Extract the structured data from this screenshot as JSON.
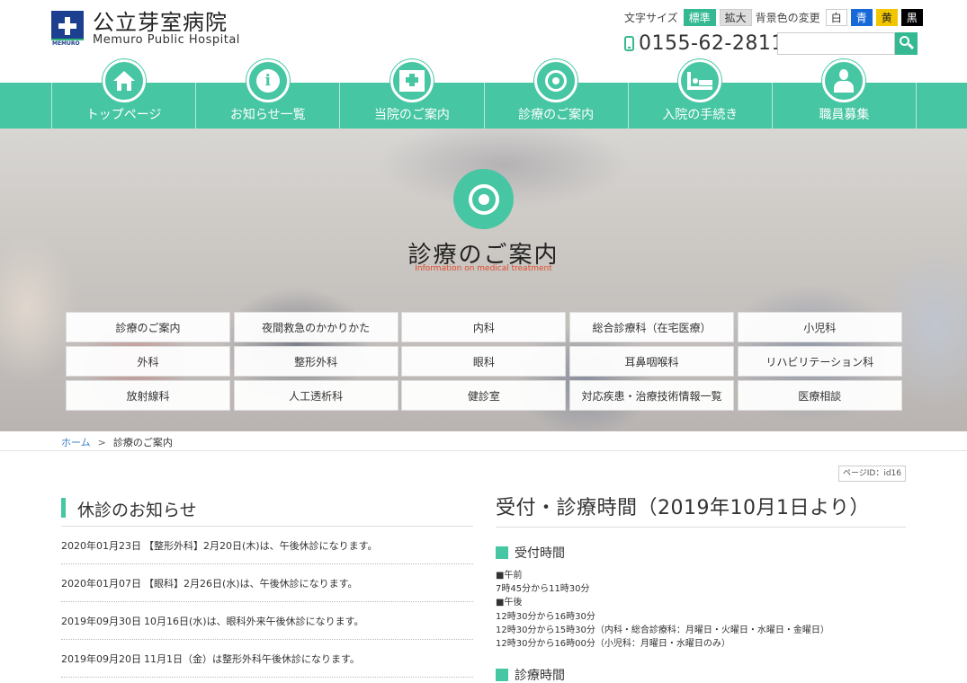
{
  "header": {
    "name_jp": "公立芽室病院",
    "name_en": "Memuro Public Hospital",
    "logo_band": "MEMURO",
    "text_size_label": "文字サイズ",
    "size_standard": "標準",
    "size_large": "拡大",
    "bg_color_label": "背景色の変更",
    "bg_white": "白",
    "bg_blue": "青",
    "bg_yellow": "黄",
    "bg_black": "黒",
    "phone": "0155-62-2811",
    "search_placeholder": "",
    "colors": {
      "accent": "#47c6a3",
      "blue": "#1769d8",
      "yellow": "#f2c600",
      "black": "#000000"
    }
  },
  "nav": {
    "items": [
      {
        "label": "トップページ",
        "icon": "home-icon"
      },
      {
        "label": "お知らせ一覧",
        "icon": "info-icon"
      },
      {
        "label": "当院のご案内",
        "icon": "hospital-book-icon"
      },
      {
        "label": "診療のご案内",
        "icon": "stethoscope-icon"
      },
      {
        "label": "入院の手続き",
        "icon": "bed-icon"
      },
      {
        "label": "職員募集",
        "icon": "staff-icon"
      }
    ]
  },
  "hero": {
    "title": "診療のご案内",
    "subtitle": "Information on medical treatment",
    "departments": [
      "診療のご案内",
      "夜間救急のかかりかた",
      "内科",
      "総合診療科（在宅医療）",
      "小児科",
      "外科",
      "整形外科",
      "眼科",
      "耳鼻咽喉科",
      "リハビリテーション科",
      "放射線科",
      "人工透析科",
      "健診室",
      "対応疾患・治療技術情報一覧",
      "医療相談"
    ]
  },
  "breadcrumb": {
    "home": "ホーム",
    "sep": ">",
    "current": "診療のご案内"
  },
  "page_id": "ページID：id16",
  "notices": {
    "title": "休診のお知らせ",
    "items": [
      {
        "date": "2020年01月23日",
        "text": "【整形外科】2月20日(木)は、午後休診になります。"
      },
      {
        "date": "2020年01月07日",
        "text": "【眼科】2月26日(水)は、午後休診になります。"
      },
      {
        "date": "2019年09月30日",
        "text": "10月16日(水)は、眼科外来午後休診になります。"
      },
      {
        "date": "2019年09月20日",
        "text": "11月1日（金）は整形外科午後休診になります。"
      }
    ]
  },
  "schedule": {
    "title": "受付・診療時間（2019年10月1日より）",
    "reception_title": "受付時間",
    "lines": [
      "■午前",
      "7時45分から11時30分",
      "■午後",
      "12時30分から16時30分",
      "12時30分から15時30分（内科・総合診療科：月曜日・火曜日・水曜日・金曜日）",
      "12時30分から16時00分（小児科：月曜日・水曜日のみ）"
    ],
    "treatment_title": "診療時間"
  }
}
